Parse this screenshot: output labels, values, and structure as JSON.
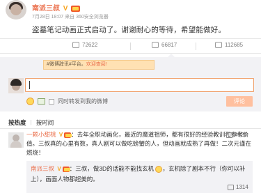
{
  "post": {
    "author": "南派三叔",
    "date": "7月28日 18:07",
    "source_prefix": "来自",
    "source": "360安全浏览器",
    "text": "盗墓笔记动画正式启动了。谢谢耐心的等待，希望能做好。"
  },
  "stats": {
    "repost": "72622",
    "comment": "66817",
    "like": "112685"
  },
  "composer": {
    "topics_prefix": "#微博辞讯#平台。",
    "topics_link": "欢迎查阅!",
    "sync_label": "同时转发到我的微博",
    "submit_label": "评论"
  },
  "sort": {
    "label": "按热度",
    "divider": "|",
    "alt": "按时间"
  },
  "comments": [
    {
      "author": "一颗小甜桃",
      "text": "：去年全职动画化，最近的魔道祖师，都有很好的经验教训和参考价值。三叔真的心里有数，真人剧可以做吃螃蟹的人，但动画就成熟了再做！二次元谨在燃烧！",
      "likes": "4920",
      "reply": {
        "author": "南派三叔",
        "text_a": "：三叔，做3D的话能不能找玄机",
        "text_b": "，玄机除了剧本不行（你可以补上），画面人物都超美的。",
        "likes": "1314"
      }
    }
  ],
  "icons": {
    "repost": "repost-icon",
    "comment": "comment-icon",
    "like": "like-icon"
  },
  "colors": {
    "accent": "#eb7350",
    "submit_bg": "#ffc09f",
    "panel_bg": "#f2f2f5"
  }
}
